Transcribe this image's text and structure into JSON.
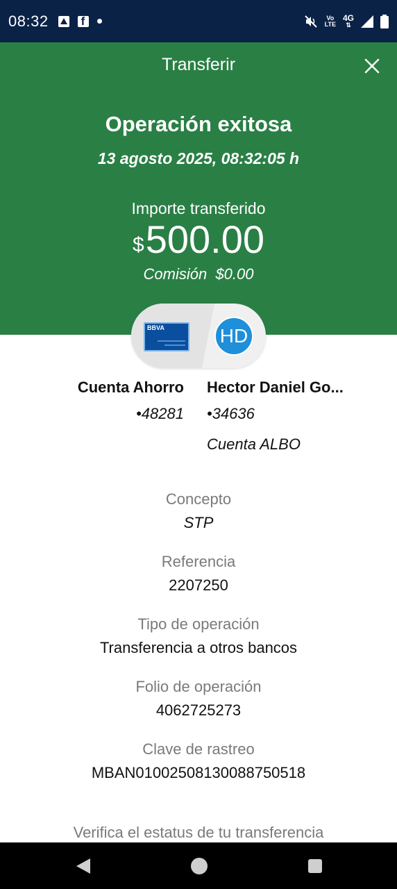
{
  "status_bar": {
    "time": "08:32",
    "network": "4G",
    "volte_line1": "Vo",
    "volte_line2": "LTE",
    "icons": [
      "app-a-icon",
      "facebook-icon",
      "notification-dot-icon",
      "mute-icon",
      "signal-icon",
      "battery-icon"
    ]
  },
  "header": {
    "title": "Transferir",
    "success_title": "Operación exitosa",
    "date": "13 agosto 2025, 08:32:05 h",
    "amount_label": "Importe transferido",
    "currency_symbol": "$",
    "amount": "500.00",
    "commission_label": "Comisión",
    "commission_value": "$0.00",
    "background_color": "#2a7f45"
  },
  "transfer": {
    "card_brand": "BBVA",
    "avatar_initials": "HD",
    "avatar_color": "#1f8fd9",
    "from": {
      "name": "Cuenta Ahorro",
      "number": "•48281"
    },
    "to": {
      "name": "Hector Daniel Go...",
      "number": "•34636",
      "bank": "Cuenta ALBO"
    }
  },
  "details": [
    {
      "label": "Concepto",
      "value": "STP"
    },
    {
      "label": "Referencia",
      "value": "2207250"
    },
    {
      "label": "Tipo de operación",
      "value": "Transferencia a otros bancos"
    },
    {
      "label": "Folio de operación",
      "value": "4062725273"
    },
    {
      "label": "Clave de rastreo",
      "value": "MBAN01002508130088750518"
    }
  ],
  "verify_text": "Verifica el estatus de tu transferencia"
}
